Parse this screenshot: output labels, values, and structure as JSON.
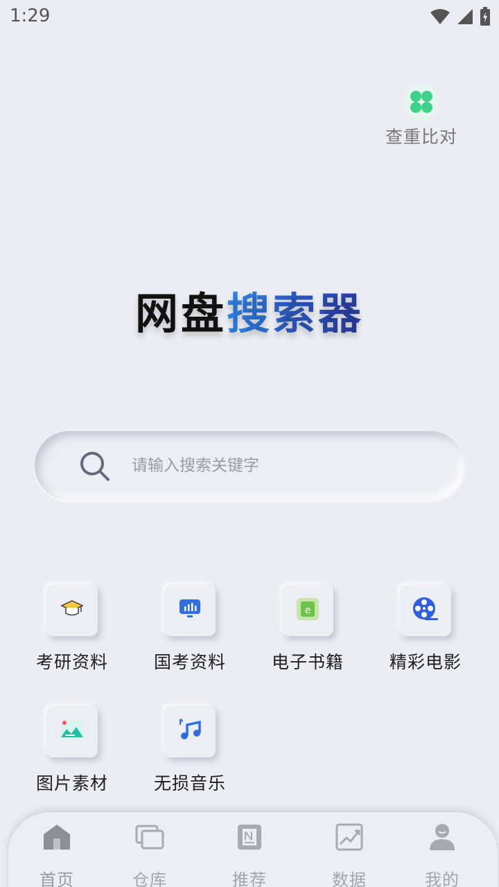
{
  "status_bar": {
    "time": "1:29"
  },
  "compare": {
    "label": "查重比对"
  },
  "logo": {
    "part1": "网盘",
    "part2": "搜索器"
  },
  "search": {
    "placeholder": "请输入搜索关键字",
    "value": ""
  },
  "categories": [
    {
      "label": "考研资料",
      "icon": "graduation-cap-icon"
    },
    {
      "label": "国考资料",
      "icon": "monitor-chart-icon"
    },
    {
      "label": "电子书籍",
      "icon": "ebook-icon"
    },
    {
      "label": "精彩电影",
      "icon": "film-reel-icon"
    },
    {
      "label": "图片素材",
      "icon": "picture-icon"
    },
    {
      "label": "无损音乐",
      "icon": "music-note-icon"
    }
  ],
  "bottom_nav": [
    {
      "label": "首页",
      "icon": "home-icon",
      "active": true
    },
    {
      "label": "仓库",
      "icon": "folder-stack-icon",
      "active": false
    },
    {
      "label": "推荐",
      "icon": "document-icon",
      "active": false
    },
    {
      "label": "数据",
      "icon": "line-chart-icon",
      "active": false
    },
    {
      "label": "我的",
      "icon": "user-icon",
      "active": false
    }
  ],
  "colors": {
    "background": "#ebedf2",
    "accent_blue": "#2f6fe0",
    "compare_green": "#3fd08a",
    "nav_inactive": "#a4a6ad"
  }
}
